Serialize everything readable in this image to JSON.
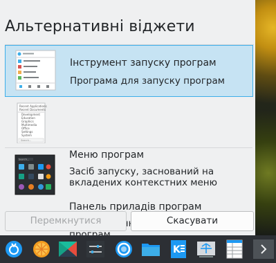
{
  "dialog": {
    "title": "Альтернативні віджети",
    "widgets": [
      {
        "name": "Інструмент запуску програм",
        "description": "Програма для запуску програм",
        "selected": true
      },
      {
        "name": "Меню програм",
        "description": "Засіб запуску, заснований на вкладених контекстних меню",
        "selected": false
      },
      {
        "name": "Панель приладів програм",
        "description": "Повноекранний засіб запуску програм",
        "selected": false
      }
    ],
    "switch_button": "Перемкнутися",
    "cancel_button": "Скасувати"
  },
  "thumbnails": {
    "menu": {
      "header": "Recent Applications",
      "items": [
        "Recent Documents",
        "Development",
        "Education",
        "Graphics",
        "Multimedia",
        "Office",
        "Settings",
        "System"
      ],
      "search": "Search..."
    },
    "dashboard": {
      "search": "Search..."
    }
  },
  "taskbar": {
    "icons": [
      "application-launcher-icon",
      "orange-app-icon",
      "kde-store-icon",
      "settings-sliders-icon",
      "browser-icon",
      "folder-icon",
      "text-editor-icon",
      "network-icon",
      "spreadsheet-icon",
      "more-arrow-icon"
    ]
  },
  "colors": {
    "selection": "#c6e3f3",
    "selection_border": "#3daee9",
    "background": "#eff0f1",
    "taskbar": "#2c2f34"
  }
}
